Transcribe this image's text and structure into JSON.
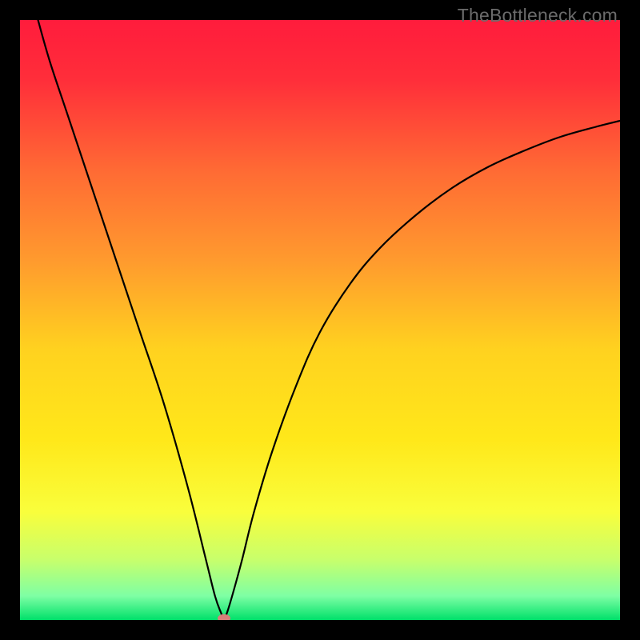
{
  "watermark": "TheBottleneck.com",
  "chart_data": {
    "type": "line",
    "title": "",
    "xlabel": "",
    "ylabel": "",
    "xlim": [
      0,
      100
    ],
    "ylim": [
      0,
      100
    ],
    "background_gradient": {
      "stops": [
        {
          "pos": 0.0,
          "color": "#ff1c3c"
        },
        {
          "pos": 0.1,
          "color": "#ff2e3a"
        },
        {
          "pos": 0.25,
          "color": "#ff6a34"
        },
        {
          "pos": 0.4,
          "color": "#ff9a2e"
        },
        {
          "pos": 0.55,
          "color": "#ffd21f"
        },
        {
          "pos": 0.7,
          "color": "#ffe81a"
        },
        {
          "pos": 0.82,
          "color": "#f9fe3c"
        },
        {
          "pos": 0.9,
          "color": "#c7ff6c"
        },
        {
          "pos": 0.96,
          "color": "#7effa4"
        },
        {
          "pos": 1.0,
          "color": "#00e06a"
        }
      ]
    },
    "series": [
      {
        "name": "bottleneck-curve",
        "color": "#000000",
        "x": [
          3,
          5,
          8,
          12,
          16,
          20,
          24,
          28,
          31,
          32.5,
          33.5,
          34,
          34.5,
          35.5,
          37,
          39,
          42,
          46,
          50,
          55,
          60,
          66,
          72,
          78,
          84,
          90,
          96,
          100
        ],
        "y": [
          100,
          93,
          84,
          72,
          60,
          48,
          36,
          22,
          10,
          4,
          1.2,
          0.3,
          1.2,
          4.5,
          10,
          18,
          28,
          39,
          48,
          56,
          62,
          67.5,
          72,
          75.5,
          78.2,
          80.5,
          82.2,
          83.2
        ]
      }
    ],
    "marker": {
      "x": 34,
      "y": 0.3,
      "color": "#d87f7a",
      "rx": 8,
      "ry": 5
    }
  }
}
